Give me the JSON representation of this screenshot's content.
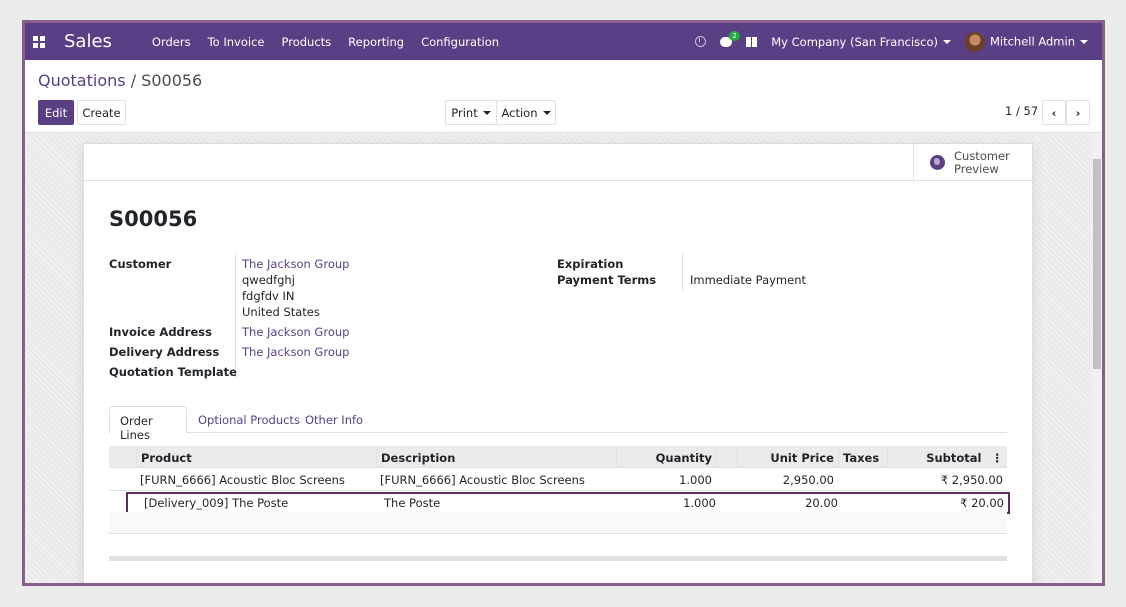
{
  "app": "Sales",
  "nav": [
    "Orders",
    "To Invoice",
    "Products",
    "Reporting",
    "Configuration"
  ],
  "chat_badge": "2",
  "company": "My Company (San Francisco)",
  "user": "Mitchell Admin",
  "breadcrumb": {
    "parent": "Quotations",
    "sep": "/",
    "current": "S00056"
  },
  "buttons": {
    "edit": "Edit",
    "create": "Create",
    "print": "Print",
    "action": "Action"
  },
  "pager": "1 / 57",
  "preview": {
    "line1": "Customer",
    "line2": "Preview"
  },
  "record_name": "S00056",
  "fields": {
    "customer_label": "Customer",
    "customer_name": "The Jackson Group",
    "customer_addr1": "qwedfghj",
    "customer_addr2": "fdgfdv IN",
    "customer_addr3": "United States",
    "invoice_label": "Invoice Address",
    "invoice_value": "The Jackson Group",
    "delivery_label": "Delivery Address",
    "delivery_value": "The Jackson Group",
    "template_label": "Quotation Template",
    "expiration_label": "Expiration",
    "payment_label": "Payment Terms",
    "payment_value": "Immediate Payment"
  },
  "tabs": [
    "Order Lines",
    "Optional Products",
    "Other Info"
  ],
  "table": {
    "headers": [
      "Product",
      "Description",
      "Quantity",
      "Unit Price",
      "Taxes",
      "Subtotal"
    ],
    "rows": [
      [
        "[FURN_6666] Acoustic Bloc Screens",
        "[FURN_6666] Acoustic Bloc Screens",
        "1.000",
        "2,950.00",
        "",
        "₹ 2,950.00"
      ],
      [
        "[Delivery_009] The Poste",
        "The Poste",
        "1.000",
        "20.00",
        "",
        "₹ 20.00"
      ]
    ]
  }
}
